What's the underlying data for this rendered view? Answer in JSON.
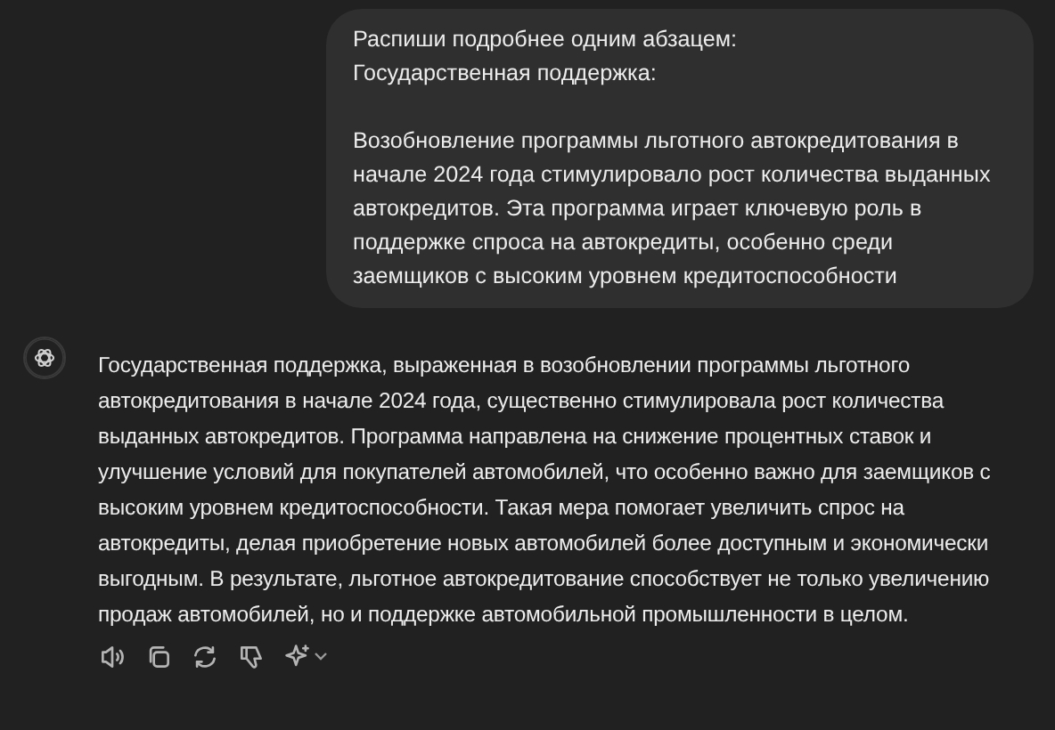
{
  "user_message": {
    "text": "Распиши подробнее одним абзацем:\nГосударственная поддержка:\n\nВозобновление программы льготного автокредитования в начале 2024 года стимулировало рост количества выданных автокредитов. Эта программа играет ключевую роль в поддержке спроса на автокредиты, особенно среди заемщиков с высоким уровнем кредитоспособности"
  },
  "assistant_message": {
    "text": "Государственная поддержка, выраженная в возобновлении программы льготного автокредитования в начале 2024 года, существенно стимулировала рост количества выданных автокредитов. Программа направлена на снижение процентных ставок и улучшение условий для покупателей автомобилей, что особенно важно для заемщиков с высоким уровнем кредитоспособности. Такая мера помогает увеличить спрос на автокредиты, делая приобретение новых автомобилей более доступным и экономически выгодным. В результате, льготное автокредитование способствует не только увеличению продаж автомобилей, но и поддержке автомобильной промышленности в целом.",
    "actions": [
      {
        "kind": "read-aloud"
      },
      {
        "kind": "copy"
      },
      {
        "kind": "regenerate"
      },
      {
        "kind": "dislike"
      },
      {
        "kind": "model"
      }
    ]
  }
}
